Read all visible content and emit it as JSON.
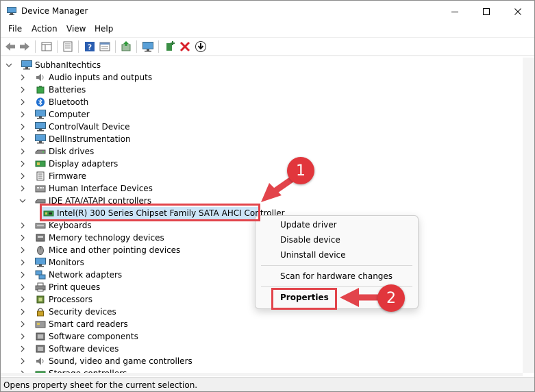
{
  "window": {
    "title": "Device Manager"
  },
  "menu": [
    "File",
    "Action",
    "View",
    "Help"
  ],
  "tree": {
    "root": "SubhanItechtics",
    "categories": [
      "Audio inputs and outputs",
      "Batteries",
      "Bluetooth",
      "Computer",
      "ControlVault Device",
      "DellInstrumentation",
      "Disk drives",
      "Display adapters",
      "Firmware",
      "Human Interface Devices",
      "IDE ATA/ATAPI controllers",
      "Keyboards",
      "Memory technology devices",
      "Mice and other pointing devices",
      "Monitors",
      "Network adapters",
      "Print queues",
      "Processors",
      "Security devices",
      "Smart card readers",
      "Software components",
      "Software devices",
      "Sound, video and game controllers",
      "Storage controllers"
    ],
    "selected_child": "Intel(R) 300 Series Chipset Family SATA AHCI Controller"
  },
  "context_menu": {
    "items": [
      "Update driver",
      "Disable device",
      "Uninstall device",
      "Scan for hardware changes",
      "Properties"
    ]
  },
  "status": "Opens property sheet for the current selection.",
  "callouts": {
    "step1": "1",
    "step2": "2"
  },
  "colors": {
    "selection": "#cce4f7",
    "highlight": "#e2444b",
    "badge": "#e1363c"
  }
}
